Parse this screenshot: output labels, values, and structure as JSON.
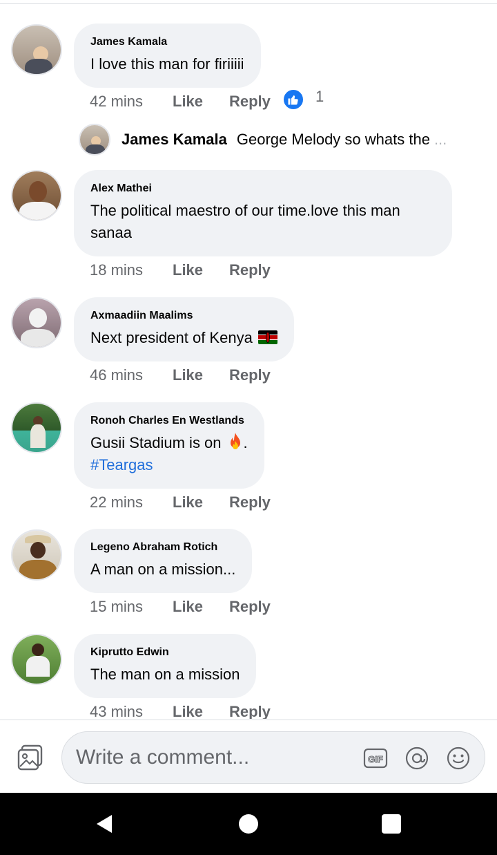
{
  "comments": [
    {
      "author": "James Kamala",
      "text": "I love this man for firiiiii",
      "time": "42 mins",
      "like": "Like",
      "reply": "Reply",
      "reactions": "1"
    },
    {
      "author": "Alex Mathei",
      "text_line1": "The political maestro of our time.love this man",
      "text_line2": "sanaa",
      "time": "18 mins",
      "like": "Like",
      "reply": "Reply"
    },
    {
      "author": "Axmaadiin Maalims",
      "text": "Next president of Kenya",
      "time": "46 mins",
      "like": "Like",
      "reply": "Reply"
    },
    {
      "author": "Ronoh Charles En Westlands",
      "text": "Gusii Stadium is on",
      "text_after": ".",
      "hashtag": "#Teargas",
      "time": "22 mins",
      "like": "Like",
      "reply": "Reply"
    },
    {
      "author": "Legeno Abraham Rotich",
      "text": "A man on a mission...",
      "time": "15 mins",
      "like": "Like",
      "reply": "Reply"
    },
    {
      "author": "Kiprutto Edwin",
      "text": "The man on a mission",
      "time": "43 mins",
      "like": "Like",
      "reply": "Reply"
    }
  ],
  "reply_preview": {
    "author": "James Kamala",
    "text": "George Melody so whats the",
    "ellipsis": "..."
  },
  "composer": {
    "placeholder": "Write a comment..."
  },
  "icons": [
    "photo-icon",
    "gif-icon",
    "mention-icon",
    "emoji-icon",
    "like-reaction-icon",
    "kenya-flag-icon",
    "fire-icon",
    "back-icon",
    "home-icon",
    "recents-icon"
  ],
  "colors": {
    "accent": "#1877f2",
    "hashtag": "#216fdb",
    "bubble": "#f0f2f5",
    "meta": "#65676b"
  }
}
